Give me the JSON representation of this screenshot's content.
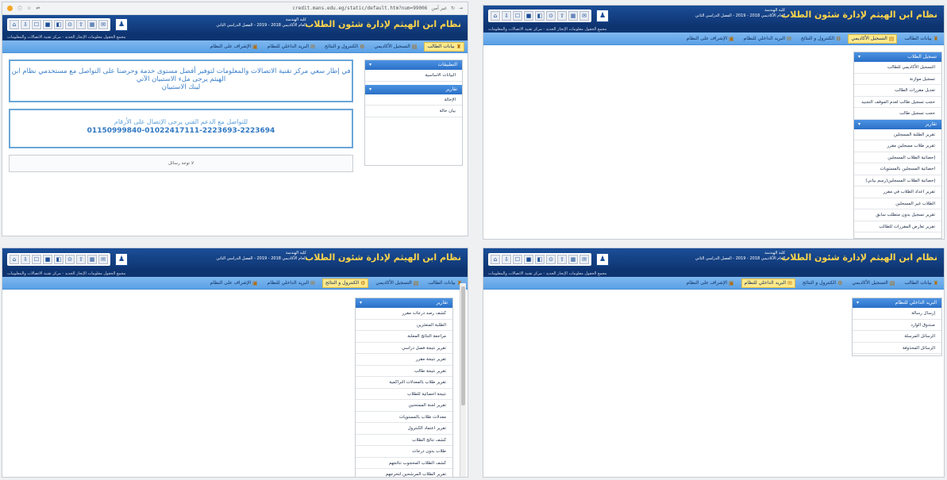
{
  "browser": {
    "url": "credit.mans.edu.eg/static/default.htm?num=99006",
    "site_label": "غير آمن"
  },
  "header": {
    "title": "نظام ابن الهيثم لإدارة شئون الطلاب",
    "faculty": "كلية الهندسة",
    "term": "العام الأكاديمي 2018 - 2019 - الفصل الدراسي الثاني",
    "sub_text": "مجمع الحقول معلومات الإنجاز الجديد - مركز تقنية الاتصالات والمعلومات",
    "icon_labels": [
      "⌂",
      "⇩",
      "☐",
      "■",
      "◧",
      "⊙",
      "⇧",
      "▦",
      "✉"
    ]
  },
  "menu": [
    {
      "label": "بيانات الطالب",
      "icon": "student-icon"
    },
    {
      "label": "التسجيل الأكاديمي",
      "icon": "registration-icon"
    },
    {
      "label": "الكنترول و النتائج",
      "icon": "control-icon"
    },
    {
      "label": "البريد الداخلي للنظام",
      "icon": "mail-icon"
    },
    {
      "label": "الإشراف على النظام",
      "icon": "admin-icon"
    }
  ],
  "panel1": {
    "sidebar": [
      {
        "title": "التطبيقات",
        "items": [
          "البيانات الاساسية"
        ]
      },
      {
        "title": "تقارير",
        "items": [
          "الإحالة",
          "بيان حالة"
        ]
      }
    ],
    "notice": "في إطار سعي مركز تقنية الاتصالات والمعلومات لتوفير أفضل مستوى خدمة وحرصنا على التواصل مع مستخدمي نظام ابن الهيثم يرجى ملء الاستبيان الآتي",
    "notice_link": "لينك الاستبيان",
    "contact_text": "للتواصل مع الدعم الفني يرجى الإتصال على الأرقام",
    "contact_numbers": "01150999840-01022417111-2223693-2223694",
    "no_messages": "لا توجد رسائل"
  },
  "panel2": {
    "sidebar": [
      {
        "title": "تسجيل الطلاب",
        "items": [
          "التسجيل الأكاديمي للطالب",
          "تسجيل موازنة",
          "تعديل مقررات الطالب",
          "حجب تسجيل طالب لعدم الموقف التجنيد",
          "حجب تسجيل طالب"
        ]
      },
      {
        "title": "تقارير",
        "items": [
          "تقرير الطلبة المسجلين",
          "تقرير طلاب مسجلين مقرر",
          "إحصائية الطلاب المسجلين",
          "احصائية المسجلين بالمستويات",
          "إحصائية الطلاب المسجلين(رسم بياني)",
          "تقرير اعداد الطلاب في مقرر",
          "الطلاب غير المسجلين",
          "تقرير تسجيل بدون متطلب سابق",
          "تقرير تعارض المقررات للطالب"
        ]
      }
    ]
  },
  "panel3": {
    "sidebar": [
      {
        "title": "تقارير",
        "items": [
          "كشف رصد درجات مقرر",
          "الطلبة المتعثرين",
          "مراجعة النتائج المعلنة",
          "تقرير نتيجة فصل دراسي",
          "تقرير نتيجة مقرر",
          "تقرير نتيجة طالب",
          "تقرير طلاب بالمعدلات التراكمية",
          "نتيجة احصائية للطلاب",
          "تقرير لجنة الممتحنين",
          "معدلات طلاب بالمستويات",
          "تقرير اعتماد الكنترول",
          "كشف نتائج الطلاب",
          "طلاب بدون درجات",
          "كشف الطلاب المحجوب نتائجهم",
          "تقرير الطلاب المرشحين لتخرجهم"
        ]
      }
    ]
  },
  "panel4": {
    "sidebar": [
      {
        "title": "البريد الداخلي للنظام",
        "items": [
          "إرسال رسالة",
          "صندوق الوارد",
          "الرسائل المرسلة",
          "الرسائل المحذوفة"
        ]
      }
    ]
  },
  "colors": {
    "header_dark": "#0e3470",
    "header_title": "#ffd64a",
    "menubar": "#5aa0e6",
    "sidebar_header": "#2a6fc7",
    "notice_text": "#3a7fc9",
    "box_border": "#6aa6d9"
  }
}
